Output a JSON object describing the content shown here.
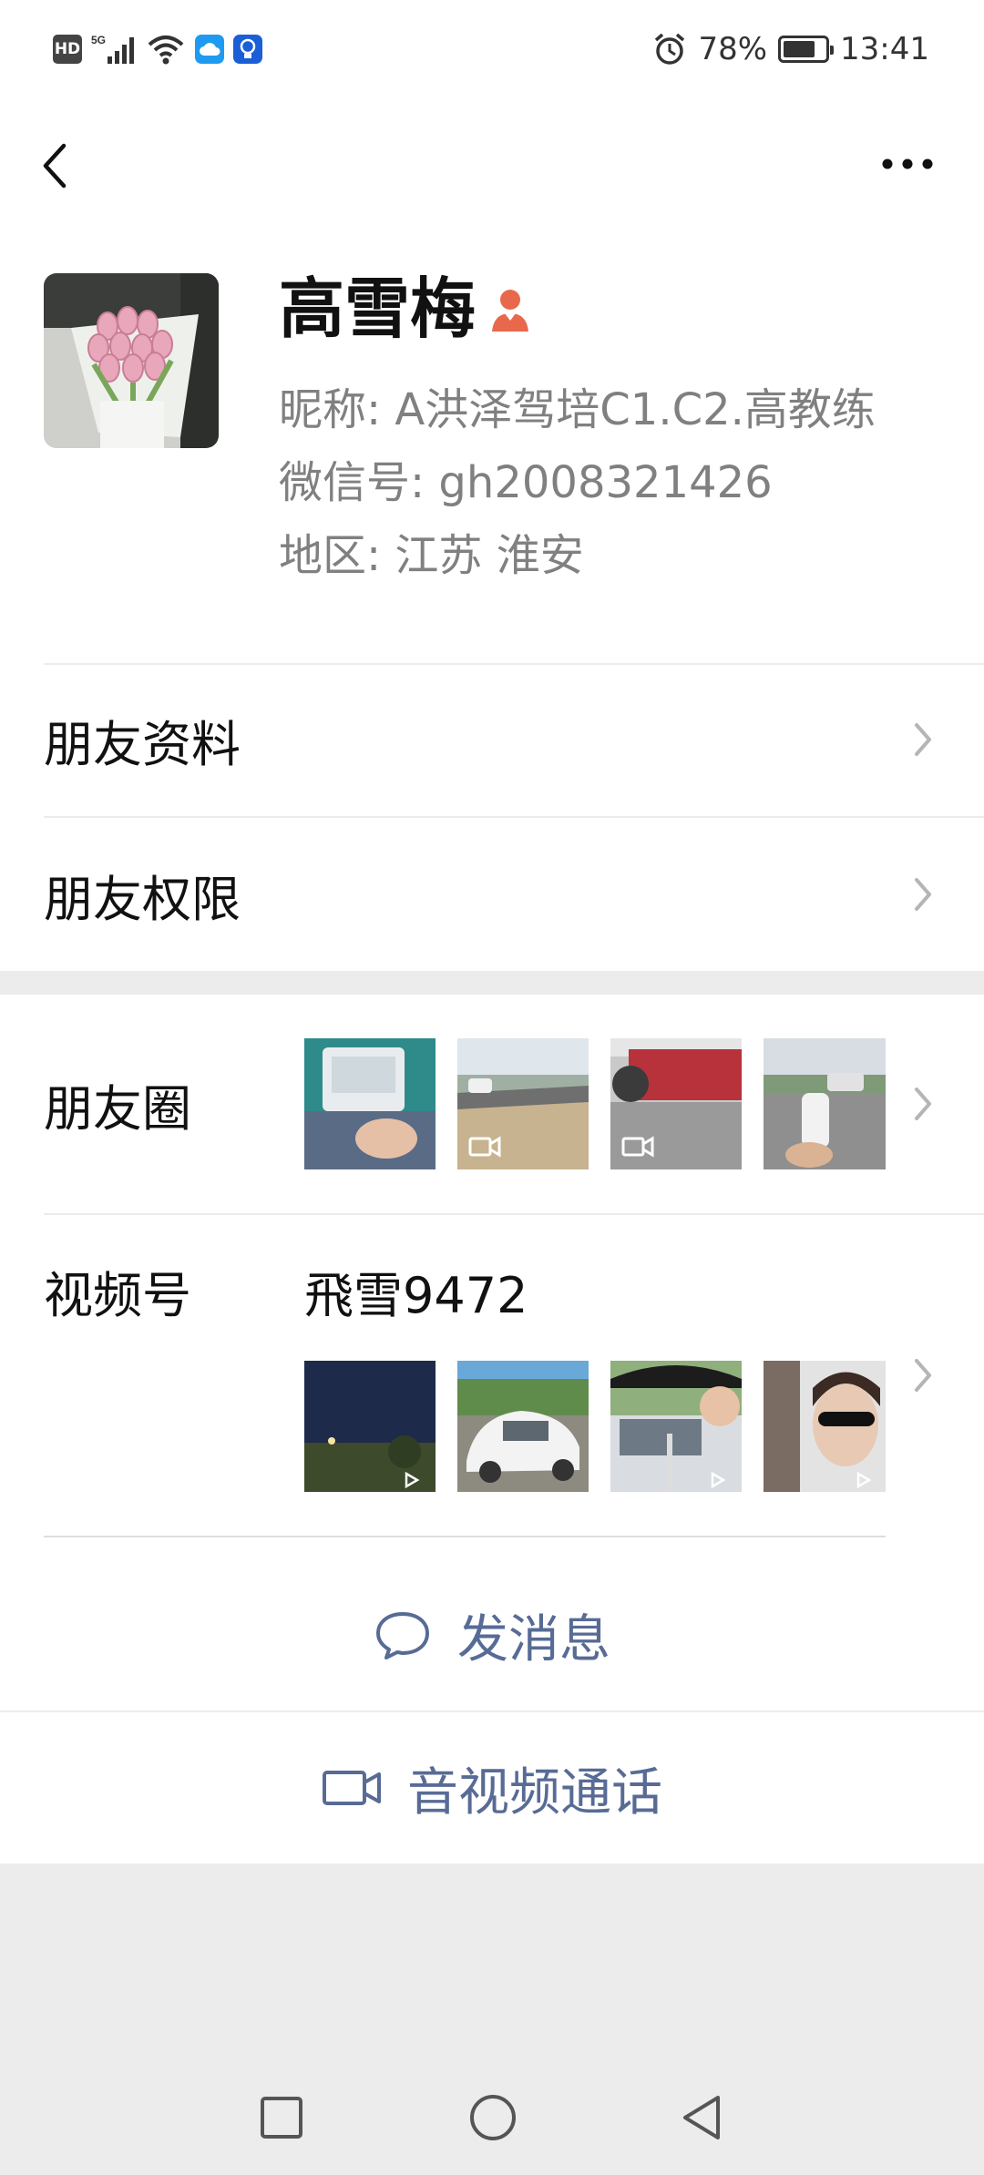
{
  "status_bar": {
    "hd": "HD",
    "network": "5G",
    "battery_percent": "78%",
    "battery_level": 0.78,
    "time": "13:41"
  },
  "header": {
    "back_icon": "chevron-left-icon",
    "more_icon": "more-dots-icon"
  },
  "profile": {
    "name": "高雪梅",
    "nickname": "昵称:  A洪泽驾培C1.C2.高教练",
    "wechat_id": "微信号:  gh2008321426",
    "region": "地区:  江苏  淮安",
    "gender_icon": "female-user-icon"
  },
  "menu": {
    "friend_info": "朋友资料",
    "friend_permissions": "朋友权限",
    "moments": "朋友圈",
    "channels": "视频号",
    "channels_name": "飛雪9472"
  },
  "moments_thumbs": [
    {
      "desc": "moments-photo-1",
      "video": false
    },
    {
      "desc": "moments-photo-2",
      "video": true
    },
    {
      "desc": "moments-photo-3",
      "video": true
    },
    {
      "desc": "moments-photo-4",
      "video": false
    }
  ],
  "channel_thumbs": [
    {
      "desc": "channel-video-1"
    },
    {
      "desc": "channel-video-2"
    },
    {
      "desc": "channel-video-3"
    },
    {
      "desc": "channel-video-4"
    }
  ],
  "actions": {
    "send_message": "发消息",
    "av_call": "音视频通话"
  },
  "colors": {
    "link_blue": "#576b95",
    "accent_orange": "#e9684c",
    "background": "#ececec"
  }
}
